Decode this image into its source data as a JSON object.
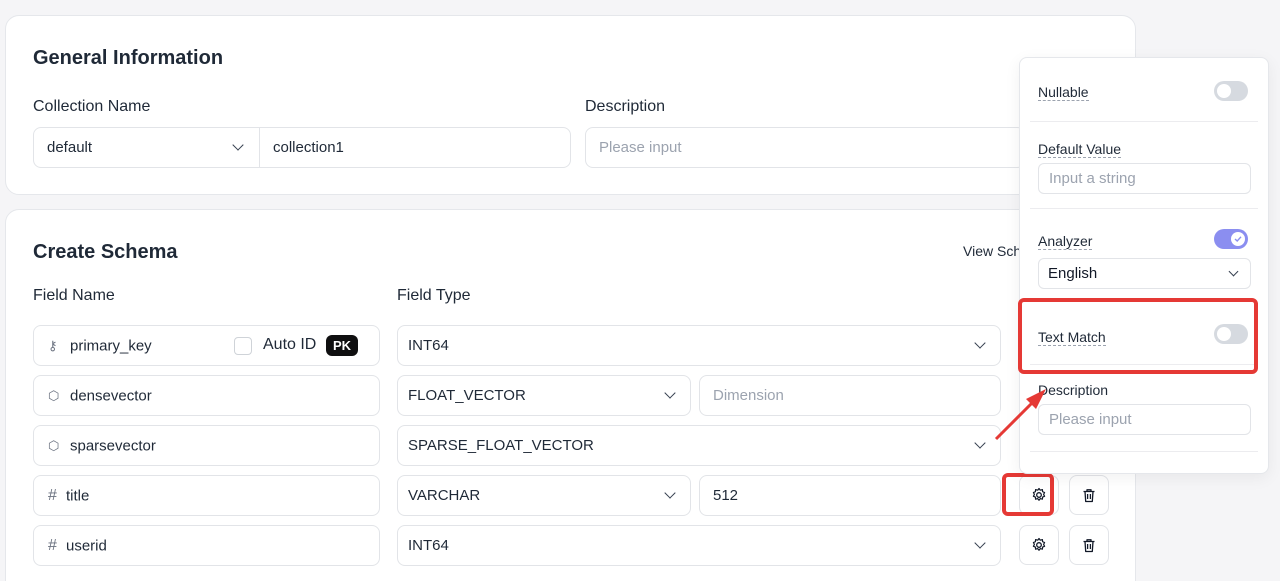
{
  "general": {
    "title": "General Information",
    "collection_name_label": "Collection Name",
    "description_label": "Description",
    "database_select": "default",
    "collection_name_value": "collection1",
    "description_placeholder": "Please input"
  },
  "schema": {
    "title": "Create Schema",
    "view_schema_link": "View Sch",
    "field_name_header": "Field Name",
    "field_type_header": "Field Type",
    "auto_id_label": "Auto ID",
    "pk_badge": "PK",
    "dimension_placeholder": "Dimension",
    "fields": [
      {
        "name": "primary_key",
        "icon": "key-icon",
        "type": "INT64"
      },
      {
        "name": "densevector",
        "icon": "vector-icon",
        "type": "FLOAT_VECTOR"
      },
      {
        "name": "sparsevector",
        "icon": "vector-icon",
        "type": "SPARSE_FLOAT_VECTOR"
      },
      {
        "name": "title",
        "icon": "hash-icon",
        "type": "VARCHAR",
        "max_length": "512"
      },
      {
        "name": "userid",
        "icon": "hash-icon",
        "type": "INT64"
      }
    ],
    "icons": {
      "key": "⚷",
      "vector": "⬡",
      "hash": "#"
    }
  },
  "settings_panel": {
    "nullable_label": "Nullable",
    "nullable_on": false,
    "default_value_label": "Default Value",
    "default_value_placeholder": "Input a string",
    "analyzer_label": "Analyzer",
    "analyzer_on": true,
    "analyzer_select": "English",
    "text_match_label": "Text Match",
    "text_match_on": false,
    "description_label": "Description",
    "description_placeholder": "Please input"
  },
  "colors": {
    "accent": "#8b8ef0",
    "toggle_off": "#d6dae0",
    "highlight": "#e53935"
  }
}
